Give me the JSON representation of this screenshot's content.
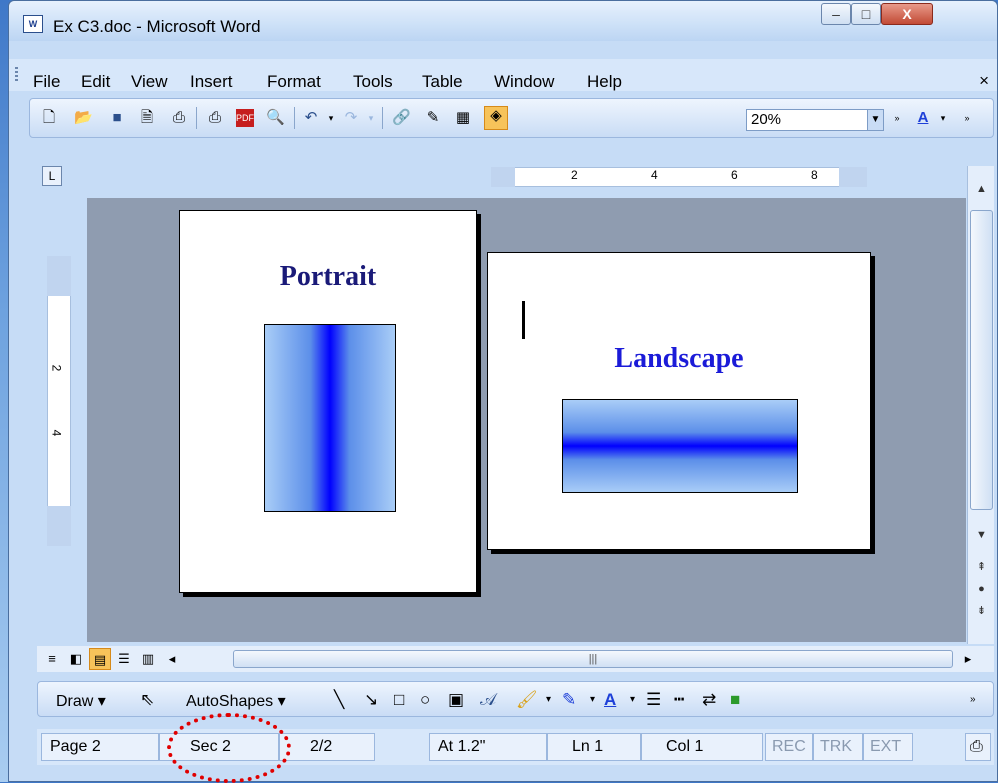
{
  "window": {
    "title": "Ex C3.doc - Microsoft Word",
    "app_icon": "word-icon"
  },
  "menubar": {
    "items": [
      "File",
      "Edit",
      "View",
      "Insert",
      "Format",
      "Tools",
      "Table",
      "Window",
      "Help"
    ],
    "close": "×"
  },
  "toolbar": {
    "zoom": "20%",
    "icons": [
      "new-icon",
      "open-icon",
      "save-icon",
      "permission-icon",
      "print-icon",
      "print-preview-icon",
      "pdf-icon",
      "research-icon",
      "undo-icon",
      "redo-icon",
      "hyperlink-icon",
      "drawing-icon",
      "table-icon",
      "docmap-icon",
      "font-color-icon"
    ]
  },
  "ruler": {
    "numbers": [
      "2",
      "4",
      "6",
      "8"
    ],
    "vertical_numbers": [
      "2",
      "4"
    ]
  },
  "document": {
    "portrait_title": "Portrait",
    "landscape_title": "Landscape"
  },
  "drawbar": {
    "draw": "Draw",
    "autoshapes": "AutoShapes"
  },
  "statusbar": {
    "page": "Page 2",
    "sec": "Sec 2",
    "count": "2/2",
    "at": "At 1.2\"",
    "ln": "Ln 1",
    "col": "Col 1",
    "rec": "REC",
    "trk": "TRK",
    "ext": "EXT"
  },
  "colors": {
    "portrait_title": "#1a1a78",
    "landscape_title": "#1b1bd8",
    "highlight": "#e00000"
  }
}
